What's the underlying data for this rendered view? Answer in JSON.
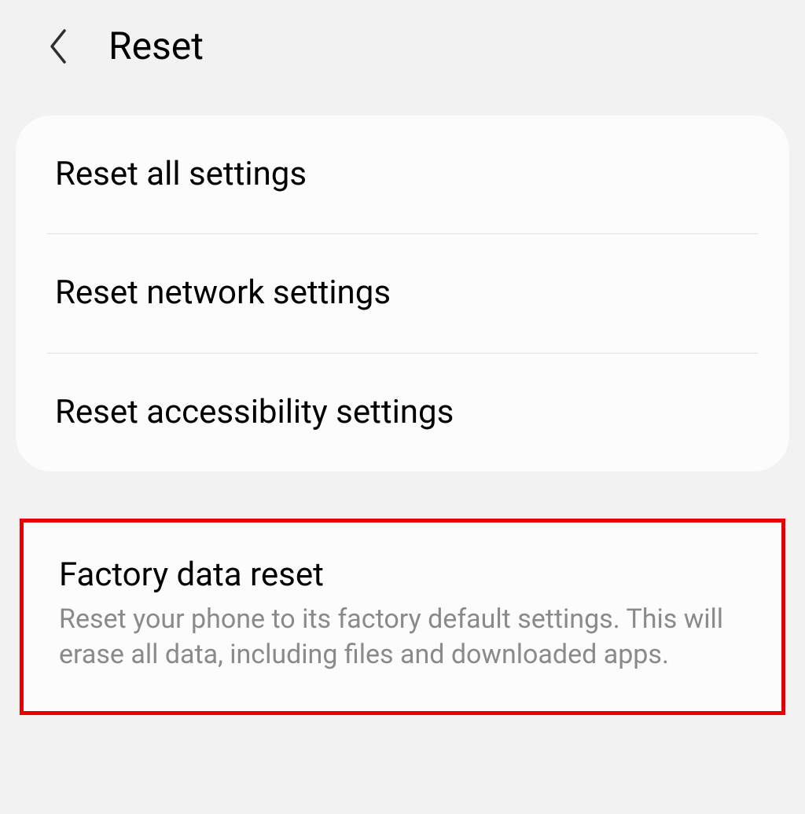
{
  "header": {
    "title": "Reset"
  },
  "group1": {
    "items": [
      {
        "title": "Reset all settings"
      },
      {
        "title": "Reset network settings"
      },
      {
        "title": "Reset accessibility settings"
      }
    ]
  },
  "group2": {
    "item": {
      "title": "Factory data reset",
      "description": "Reset your phone to its factory default settings. This will erase all data, including files and downloaded apps."
    }
  }
}
